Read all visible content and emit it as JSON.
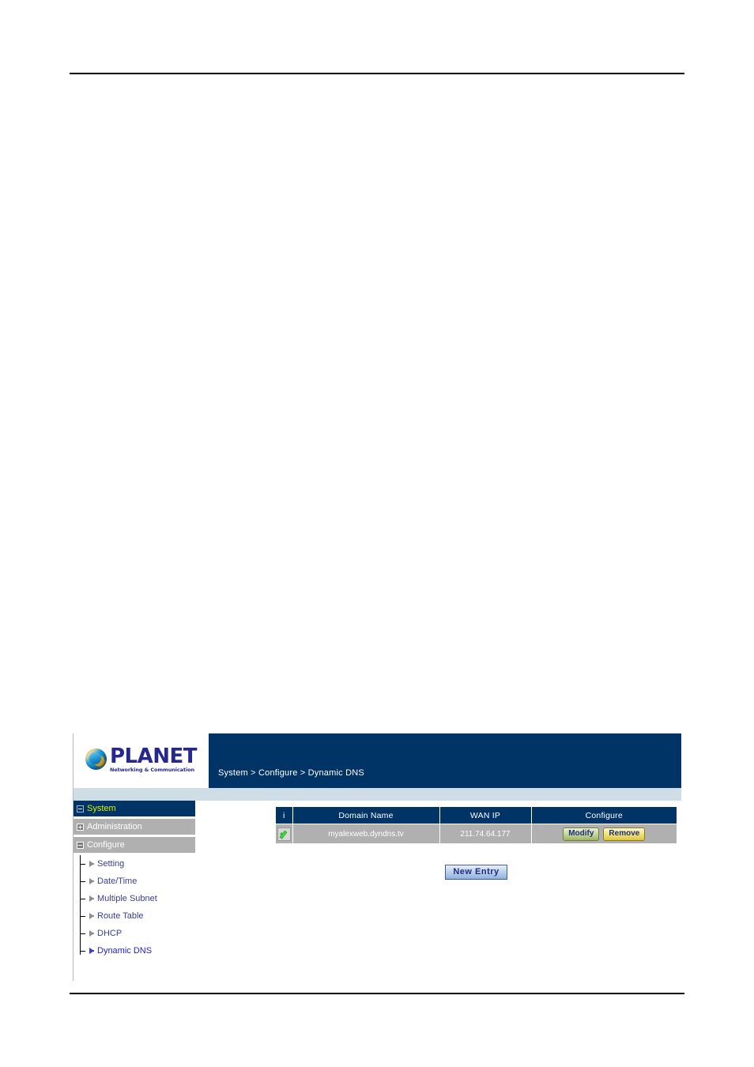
{
  "screenshot": {
    "header": {
      "logo_word": "PLANET",
      "logo_tagline": "Networking & Communication",
      "breadcrumb": "System > Configure > Dynamic DNS"
    },
    "sidebar": {
      "root": {
        "label": "System"
      },
      "groups": [
        {
          "label": "Administration",
          "expanded": false
        },
        {
          "label": "Configure",
          "expanded": true
        }
      ],
      "items": [
        {
          "label": "Setting",
          "active": false
        },
        {
          "label": "Date/Time",
          "active": false
        },
        {
          "label": "Multiple Subnet",
          "active": false
        },
        {
          "label": "Route Table",
          "active": false
        },
        {
          "label": "DHCP",
          "active": false
        },
        {
          "label": "Dynamic DNS",
          "active": true
        }
      ]
    },
    "table": {
      "headers": {
        "info": "i",
        "domain_name": "Domain Name",
        "wan_ip": "WAN IP",
        "configure": "Configure"
      },
      "rows": [
        {
          "status_icon": "green-check-icon",
          "domain_name": "myalexweb.dyndns.tv",
          "wan_ip": "211.74.64.177",
          "modify_label": "Modify",
          "remove_label": "Remove"
        }
      ]
    },
    "actions": {
      "new_entry_label": "New  Entry"
    },
    "colors": {
      "header_navy": "#003366",
      "strip_blue": "#cfdde7",
      "row_gray": "#b0b0b0",
      "active_link": "#2222cc",
      "root_label": "#d9f000"
    }
  }
}
